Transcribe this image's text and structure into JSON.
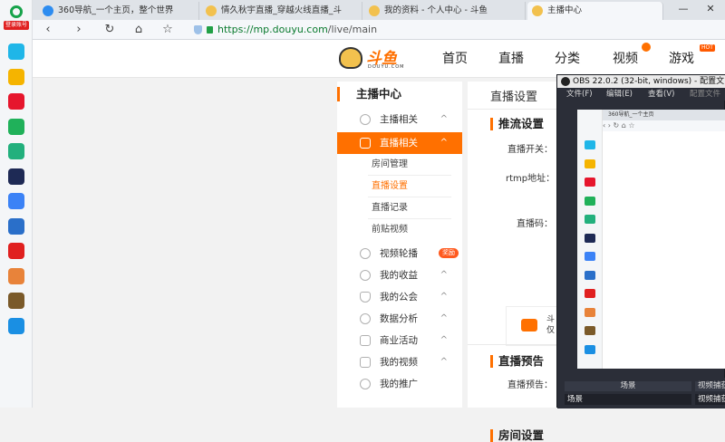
{
  "side_strip": {
    "logo_tag": "登录账号",
    "icons": [
      {
        "name": "grid-app-icon",
        "color": "#1fb6e8"
      },
      {
        "name": "star-app-icon",
        "color": "#f5b400"
      },
      {
        "name": "weibo-icon",
        "color": "#e6162d"
      },
      {
        "name": "green-card-icon",
        "color": "#20b15a"
      },
      {
        "name": "cloud-link-icon",
        "color": "#22b07d"
      },
      {
        "name": "game-app-icon",
        "color": "#1e2a55"
      },
      {
        "name": "doc-app-icon",
        "color": "#3b82f6"
      },
      {
        "name": "scenery-app-icon",
        "color": "#2a6fc9"
      },
      {
        "name": "red-app-icon",
        "color": "#e02020"
      },
      {
        "name": "colorful-game-icon",
        "color": "#e8833a"
      },
      {
        "name": "war-game-icon",
        "color": "#7a5a2a"
      },
      {
        "name": "ip-app-icon",
        "color": "#1a8fe3"
      }
    ]
  },
  "tabs": [
    {
      "label": "360导航_一个主页，整个世界",
      "icon_color": "#2d8cf0"
    },
    {
      "label": "情久秋宇直播_穿越火线直播_斗",
      "icon_color": "#f2c14e"
    },
    {
      "label": "我的资料 - 个人中心 - 斗鱼",
      "icon_color": "#f2c14e"
    },
    {
      "label": "主播中心",
      "icon_color": "#f2c14e"
    }
  ],
  "window_controls": {
    "minimize": "—",
    "close": "✕"
  },
  "address": {
    "scheme": "https://",
    "host": "mp.douyu.com",
    "path": "/live/main"
  },
  "nav_glyphs": {
    "back": "‹",
    "forward": "›",
    "reload": "↻",
    "home": "⌂",
    "bookmark": "☆"
  },
  "brand": {
    "name": "斗鱼",
    "domain": "DOUYU.COM"
  },
  "top_nav": [
    "首页",
    "直播",
    "分类",
    "视频",
    "游戏"
  ],
  "hot_tag": "HOT",
  "menu": {
    "title": "主播中心",
    "items": [
      {
        "label": "主播相关",
        "caret": "^"
      },
      {
        "label": "直播相关",
        "caret": "^",
        "active": true
      },
      {
        "label": "视频轮播",
        "badge": "奖励"
      },
      {
        "label": "我的收益",
        "caret": "^"
      },
      {
        "label": "我的公会",
        "caret": "^"
      },
      {
        "label": "数据分析",
        "caret": "^"
      },
      {
        "label": "商业活动",
        "caret": "^"
      },
      {
        "label": "我的视频",
        "caret": "^"
      },
      {
        "label": "我的推广"
      }
    ],
    "subitems": [
      "房间管理",
      "直播设置",
      "直播记录",
      "前贴视频"
    ]
  },
  "content": {
    "title": "直播设置",
    "sections": [
      "推流设置",
      "直播预告",
      "房间设置"
    ],
    "labels": [
      "直播开关：",
      "rtmp地址：",
      "直播码：",
      "直播预告："
    ],
    "card_text": [
      "斗",
      "仅"
    ]
  },
  "obs": {
    "title": "OBS 22.0.2 (32-bit, windows) - 配置文",
    "menus": [
      "文件(F)",
      "编辑(E)",
      "查看(V)",
      "配置文件"
    ],
    "preview_tabs": "360导航_一个主页",
    "preview_url": "‹  ›  ↻  ⌂  ☆",
    "dock_headers": [
      "场景",
      "视频捕获"
    ],
    "dock_items": [
      "场景",
      "视频捕获"
    ]
  }
}
